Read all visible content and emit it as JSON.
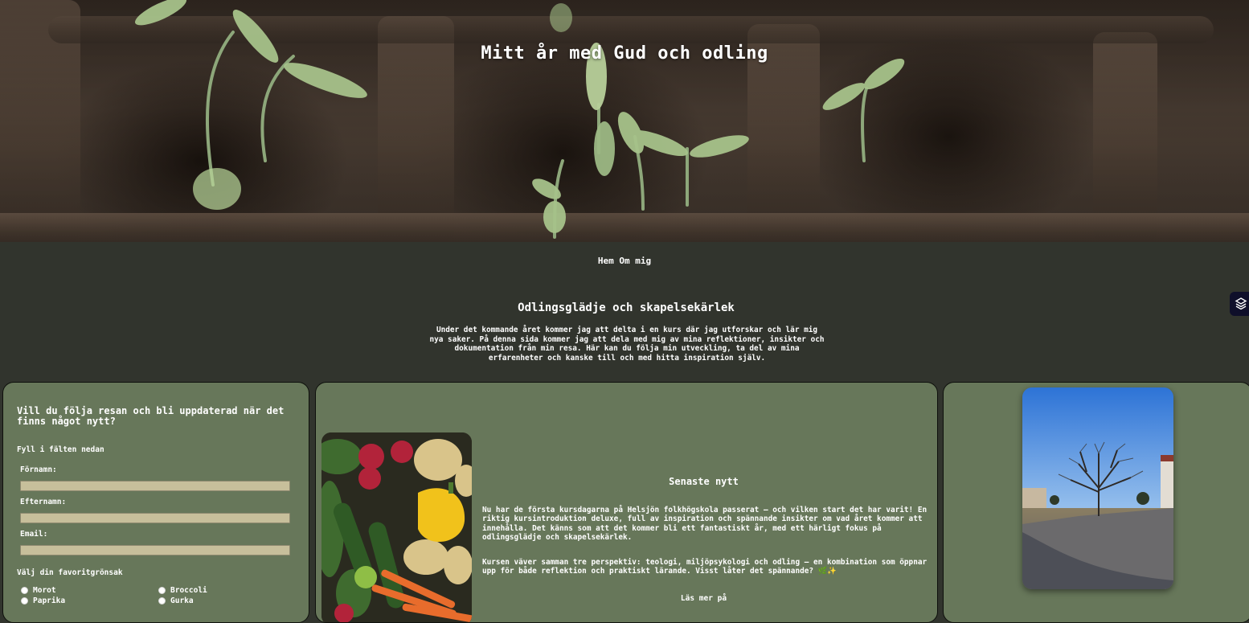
{
  "hero": {
    "title": "Mitt år med Gud och odling"
  },
  "nav": {
    "items": [
      "Hem",
      "Om mig"
    ]
  },
  "intro": {
    "title": "Odlingsglädje och skapelsekärlek",
    "text": "Under det kommande året kommer jag att delta i en kurs där jag utforskar och lär mig nya saker. På denna sida kommer jag att dela med mig av mina reflektioner, insikter och dokumentation från min resa. Här kan du följa min utveckling, ta del av mina erfarenheter och kanske till och med hitta inspiration själv."
  },
  "form": {
    "heading": "Vill du följa resan och bli uppdaterad när det finns något nytt?",
    "instruction": "Fyll i fälten nedan",
    "fields": {
      "firstname_label": "Förnamn:",
      "lastname_label": "Efternamn:",
      "email_label": "Email:"
    },
    "veg_title": "Välj din favoritgrönsak",
    "veg_options": [
      "Morot",
      "Broccoli",
      "Paprika",
      "Gurka"
    ]
  },
  "news": {
    "title": "Senaste nytt",
    "paragraph1": "Nu har de första kursdagarna på Helsjön folkhögskola passerat – och vilken start det har varit! En riktig kursintroduktion deluxe, full av inspiration och spännande insikter om vad året kommer att innehålla. Det känns som att det kommer bli ett fantastiskt år, med ett härligt fokus på odlingsglädje och skapelsekärlek.",
    "paragraph2": "Kursen väver samman tre perspektiv: teologi, miljöpsykologi och odling – en kombination som öppnar upp för både reflektion och praktiskt lärande. Visst låter det spännande? 🌿✨",
    "read_more": "Läs mer på"
  },
  "colors": {
    "page_bg": "#31342d",
    "card_bg": "#67775a",
    "input_bg": "#c7bf9b",
    "text": "#ffffff"
  },
  "icons": {
    "side_badge": "layers-app-icon"
  }
}
